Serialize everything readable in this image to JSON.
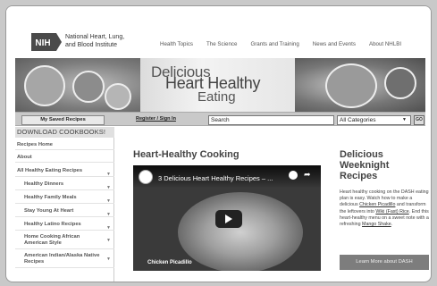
{
  "header": {
    "logo_text": "NIH",
    "institute_line1": "National Heart, Lung,",
    "institute_line2": "and Blood Institute",
    "nav": [
      "Health Topics",
      "The Science",
      "Grants and Training",
      "News and Events",
      "About NHLBI"
    ]
  },
  "banner": {
    "line1": "Delicious",
    "line2": "Heart Healthy",
    "line3": "Eating"
  },
  "toolbar": {
    "saved_label": "My Saved Recipes",
    "register_label": "Register / Sign In",
    "search_value": "Search",
    "category_value": "All Categories",
    "go_label": "GO"
  },
  "sidebar": {
    "heading": "DOWNLOAD COOKBOOKS!",
    "items": [
      {
        "label": "Recipes Home"
      },
      {
        "label": "About"
      },
      {
        "label": "All Healthy Eating Recipes"
      },
      {
        "label": "Healthy Dinners"
      },
      {
        "label": "Healthy Family Meals"
      },
      {
        "label": "Stay Young At Heart"
      },
      {
        "label": "Healthy Latino Recipes"
      },
      {
        "label": "Home Cooking African American Style"
      },
      {
        "label": "American Indian/Alaska Native Recipes"
      }
    ]
  },
  "main": {
    "title": "Heart-Healthy Cooking",
    "video_title": "3 Delicious Heart Healthy Recipes – ...",
    "video_caption": "Chicken Picadillo"
  },
  "aside": {
    "title_line1": "Delicious",
    "title_line2": "Weeknight",
    "title_line3": "Recipes",
    "text1": "Heart healthy cooking on the DASH eating plan is easy. Watch how to make a delicious ",
    "link1": "Chicken Picadillo",
    "text2": " and transform the leftovers into ",
    "link2": "Wiki (Fast) Rice",
    "text3": ". End this heart-healthy menu on a sweet note with a refreshing ",
    "link3": "Mango Shake",
    "text4": ".",
    "button_label": "Learn More about DASH"
  }
}
